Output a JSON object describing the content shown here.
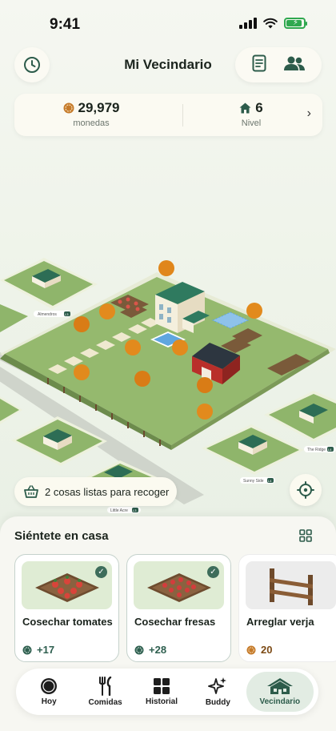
{
  "status_bar": {
    "time": "9:41"
  },
  "header": {
    "title": "Mi Vecindario",
    "history_icon": "clock-icon",
    "actions": [
      "list-icon",
      "friends-icon"
    ]
  },
  "stats": {
    "coins": {
      "value": "29,979",
      "label": "monedas",
      "icon": "coin-icon"
    },
    "level": {
      "value": "6",
      "label": "Nivel",
      "icon": "house-icon"
    }
  },
  "map": {
    "labels": {
      "almendros": "Almendros",
      "almendros_badge": "L3",
      "the_ridge": "The Ridge",
      "the_ridge_badge": "L4",
      "sunny_side": "Sunny Side",
      "sunny_side_badge": "L4",
      "little_acre": "Little Acre",
      "little_acre_badge": "L3"
    },
    "collect_pill": "2 cosas listas para recoger"
  },
  "sheet": {
    "title": "Siéntete en casa",
    "cards": [
      {
        "title": "Cosechar tomates",
        "reward": "+17",
        "checked": true
      },
      {
        "title": "Cosechar fresas",
        "reward": "+28",
        "checked": true
      },
      {
        "title": "Arreglar verja",
        "reward": "20",
        "checked": false
      }
    ]
  },
  "nav": {
    "items": [
      {
        "label": "Hoy",
        "icon": "today-icon"
      },
      {
        "label": "Comidas",
        "icon": "cutlery-icon"
      },
      {
        "label": "Historial",
        "icon": "grid-icon"
      },
      {
        "label": "Buddy",
        "icon": "sparkle-icon"
      },
      {
        "label": "Vecindario",
        "icon": "neighborhood-icon"
      }
    ],
    "active": "Vecindario"
  },
  "colors": {
    "accent": "#2e5f4f",
    "coin": "#c57a2a",
    "grass": "#8fb56b",
    "active_nav": "#e2ece3"
  }
}
